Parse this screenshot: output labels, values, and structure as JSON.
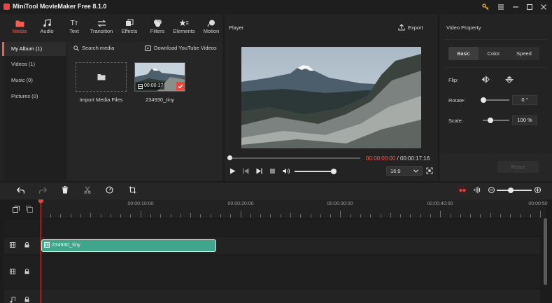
{
  "app": {
    "title": "MiniTool MovieMaker Free 8.1.0"
  },
  "toolbar": {
    "tabs": [
      {
        "label": "Media",
        "icon": "folder-icon",
        "active": true
      },
      {
        "label": "Audio",
        "icon": "music-note-icon"
      },
      {
        "label": "Text",
        "icon": "text-icon"
      },
      {
        "label": "Transition",
        "icon": "transition-icon"
      },
      {
        "label": "Effects",
        "icon": "effects-icon"
      },
      {
        "label": "Filters",
        "icon": "filters-icon"
      },
      {
        "label": "Elements",
        "icon": "elements-icon"
      },
      {
        "label": "Motion",
        "icon": "motion-icon"
      }
    ]
  },
  "album": {
    "items": [
      {
        "label": "My Album (1)",
        "active": true
      },
      {
        "label": "Videos (1)"
      },
      {
        "label": "Music (0)"
      },
      {
        "label": "Pictures (0)"
      }
    ]
  },
  "media": {
    "search_label": "Search media",
    "download_label": "Download YouTube Videos",
    "import_label": "Import Media Files",
    "clip_name": "234930_tiny",
    "clip_duration": "00:00:17"
  },
  "player": {
    "title": "Player",
    "export_label": "Export",
    "time_current": "00:00:00:00",
    "time_separator": " / ",
    "time_total": "00:00:17:16",
    "aspect": "16:9"
  },
  "properties": {
    "title": "Video Property",
    "tabs": [
      "Basic",
      "Color",
      "Speed"
    ],
    "flip_label": "Flip:",
    "rotate_label": "Rotate:",
    "rotate_value": "0 °",
    "scale_label": "Scale:",
    "scale_value": "100 %",
    "reset_label": "Reset"
  },
  "timeline": {
    "ruler_labels": [
      "00:00:10:00",
      "00:00:20:00",
      "00:00:30:00",
      "00:00:40:00",
      "00:00:50"
    ],
    "clip_label": "234930_tiny"
  },
  "colors": {
    "accent": "#ff5a4e",
    "clip": "#3fa58b",
    "playhead": "#e0463c"
  }
}
